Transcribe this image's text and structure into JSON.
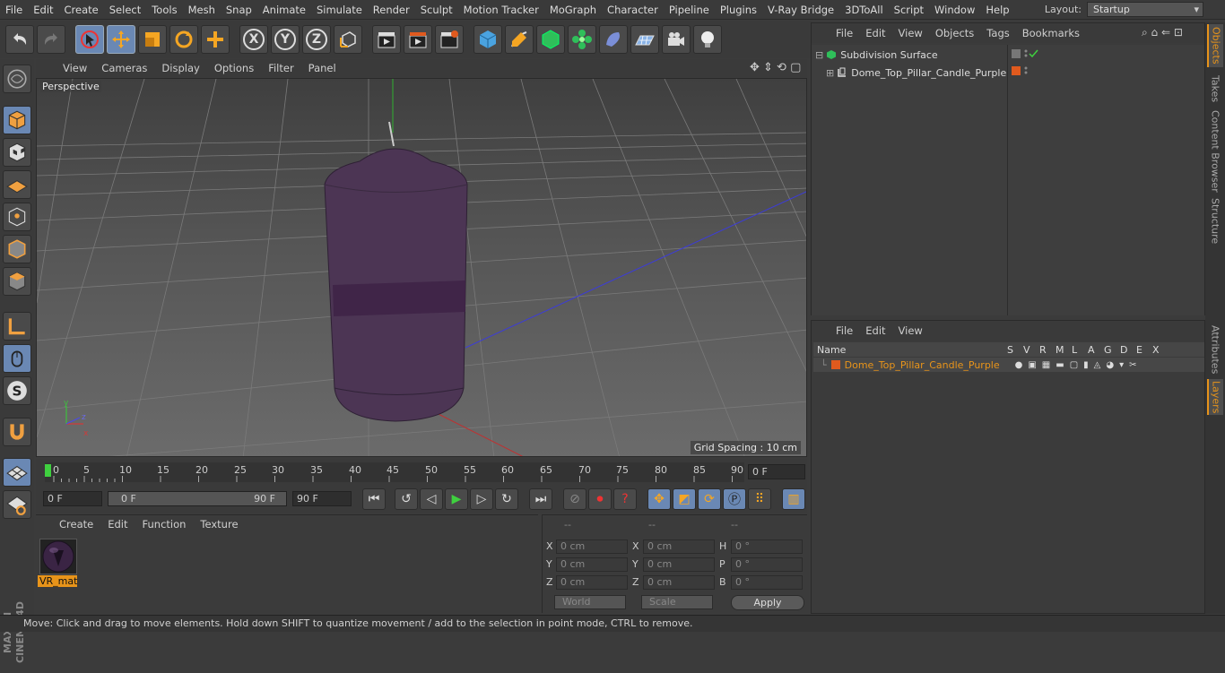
{
  "menubar": {
    "items": [
      "File",
      "Edit",
      "Create",
      "Select",
      "Tools",
      "Mesh",
      "Snap",
      "Animate",
      "Simulate",
      "Render",
      "Sculpt",
      "Motion Tracker",
      "MoGraph",
      "Character",
      "Pipeline",
      "Plugins",
      "V-Ray Bridge",
      "3DToAll",
      "Script",
      "Window",
      "Help"
    ],
    "layout_label": "Layout:",
    "layout_value": "Startup"
  },
  "toolbar": {
    "axis_x": "X",
    "axis_y": "Y",
    "axis_z": "Z"
  },
  "viewport": {
    "menu": [
      "View",
      "Cameras",
      "Display",
      "Options",
      "Filter",
      "Panel"
    ],
    "camera_label": "Perspective",
    "grid_spacing": "Grid Spacing : 10 cm"
  },
  "timeline": {
    "ticks": [
      "0",
      "5",
      "10",
      "15",
      "20",
      "25",
      "30",
      "35",
      "40",
      "45",
      "50",
      "55",
      "60",
      "65",
      "70",
      "75",
      "80",
      "85",
      "90"
    ],
    "current_frame": "0 F"
  },
  "transport": {
    "start_field": "0 F",
    "range_start": "0 F",
    "range_end": "90 F",
    "end_field": "90 F"
  },
  "material_manager": {
    "menu": [
      "Create",
      "Edit",
      "Function",
      "Texture"
    ],
    "materials": [
      {
        "name": "VR_mat"
      }
    ]
  },
  "coordinates": {
    "headers": [
      "--",
      "--",
      "--"
    ],
    "rows": [
      {
        "pos_label": "X",
        "pos": "0 cm",
        "size_label": "X",
        "size": "0 cm",
        "rot_label": "H",
        "rot": "0 °"
      },
      {
        "pos_label": "Y",
        "pos": "0 cm",
        "size_label": "Y",
        "size": "0 cm",
        "rot_label": "P",
        "rot": "0 °"
      },
      {
        "pos_label": "Z",
        "pos": "0 cm",
        "size_label": "Z",
        "size": "0 cm",
        "rot_label": "B",
        "rot": "0 °"
      }
    ],
    "world_dropdown": "World",
    "scale_dropdown": "Scale",
    "apply_label": "Apply"
  },
  "object_manager": {
    "menu": [
      "File",
      "Edit",
      "View",
      "Objects",
      "Tags",
      "Bookmarks"
    ],
    "objects": [
      {
        "name": "Subdivision Surface"
      },
      {
        "name": "Dome_Top_Pillar_Candle_Purple"
      }
    ]
  },
  "layer_manager": {
    "menu": [
      "File",
      "Edit",
      "View"
    ],
    "columns": [
      "Name",
      "S",
      "V",
      "R",
      "M",
      "L",
      "A",
      "G",
      "D",
      "E",
      "X"
    ],
    "layers": [
      {
        "name": "Dome_Top_Pillar_Candle_Purple",
        "color": "#e05a1e"
      }
    ]
  },
  "right_tabs": [
    "Objects",
    "Takes",
    "Content Browser",
    "Structure",
    "Attributes",
    "Layers"
  ],
  "status": "Move: Click and drag to move elements. Hold down SHIFT to quantize movement / add to the selection in point mode, CTRL to remove.",
  "colors": {
    "accent": "#e8941a",
    "selection": "#6a88b4",
    "layer_orange": "#e05a1e"
  }
}
